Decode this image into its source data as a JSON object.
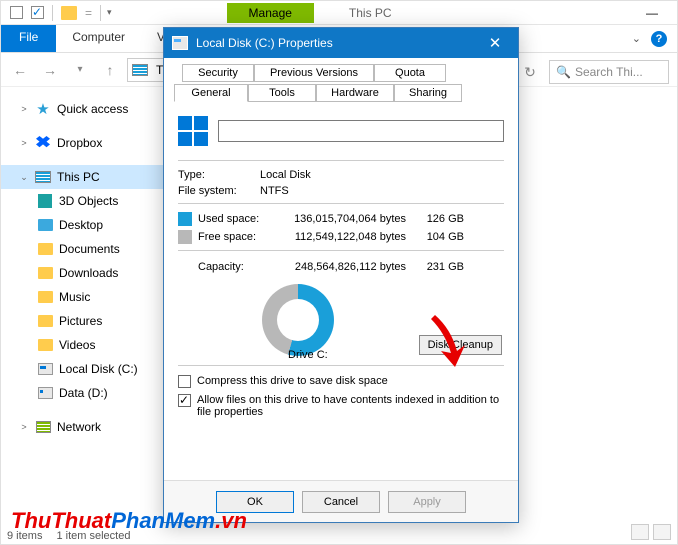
{
  "qat": {
    "manage": "Manage",
    "title": "This PC"
  },
  "ribbon": {
    "file": "File",
    "computer": "Computer",
    "view": "View"
  },
  "addr": {
    "crumb": "Th",
    "search_placeholder": "Search Thi..."
  },
  "tree": {
    "quick_access": "Quick access",
    "dropbox": "Dropbox",
    "this_pc": "This PC",
    "objects3d": "3D Objects",
    "desktop": "Desktop",
    "documents": "Documents",
    "downloads": "Downloads",
    "music": "Music",
    "pictures": "Pictures",
    "videos": "Videos",
    "local_disk_c": "Local Disk (C:)",
    "data_d": "Data (D:)",
    "network": "Network"
  },
  "dialog": {
    "title": "Local Disk (C:) Properties",
    "tabs": {
      "security": "Security",
      "previous": "Previous Versions",
      "quota": "Quota",
      "general": "General",
      "tools": "Tools",
      "hardware": "Hardware",
      "sharing": "Sharing"
    },
    "type_label": "Type:",
    "type_value": "Local Disk",
    "fs_label": "File system:",
    "fs_value": "NTFS",
    "used_label": "Used space:",
    "used_bytes": "136,015,704,064 bytes",
    "used_gb": "126 GB",
    "free_label": "Free space:",
    "free_bytes": "112,549,122,048 bytes",
    "free_gb": "104 GB",
    "cap_label": "Capacity:",
    "cap_bytes": "248,564,826,112 bytes",
    "cap_gb": "231 GB",
    "drive_label": "Drive C:",
    "cleanup_btn": "Disk Cleanup",
    "compress": "Compress this drive to save disk space",
    "allow_index": "Allow files on this drive to have contents indexed in addition to file properties",
    "ok": "OK",
    "cancel": "Cancel",
    "apply": "Apply"
  },
  "status": {
    "items": "9 items",
    "selected": "1 item selected"
  },
  "watermark": {
    "part1": "ThuThuat",
    "part2": "PhanMem",
    "part3": ".vn"
  }
}
